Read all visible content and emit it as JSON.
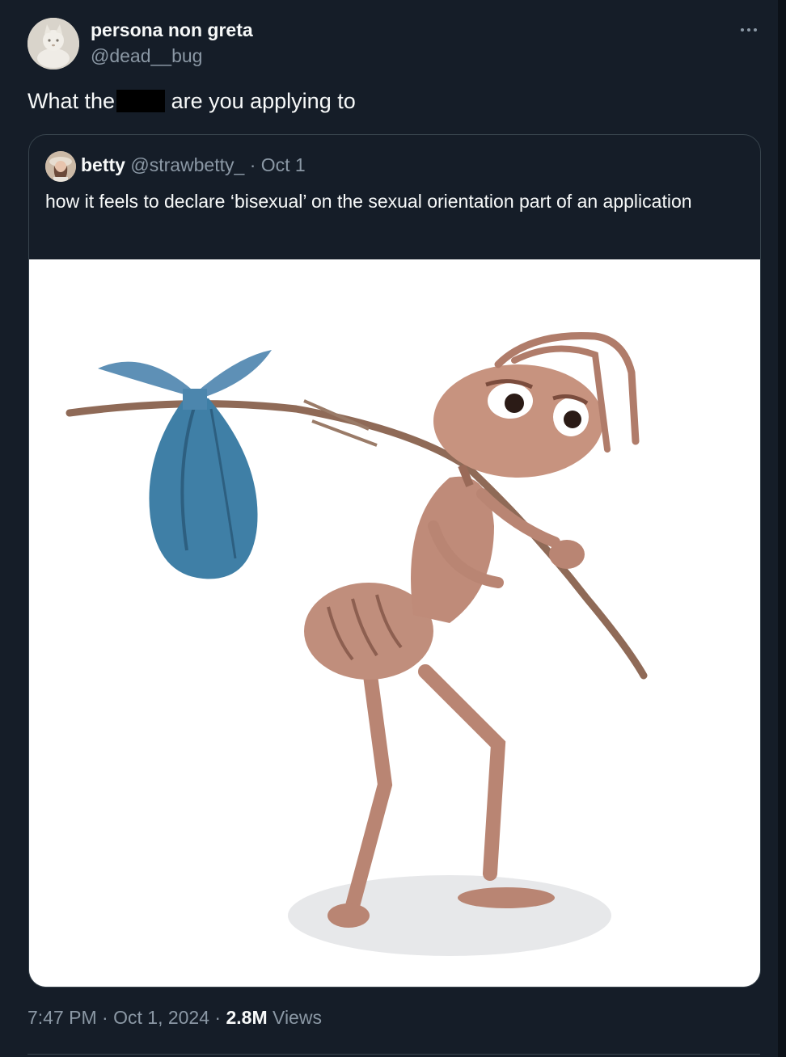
{
  "author": {
    "name": "persona non greta",
    "handle": "@dead__bug",
    "avatar_icon": "cat-statue-avatar"
  },
  "tweet": {
    "text_before": "What the",
    "text_after": "are you applying to",
    "redacted": true
  },
  "quoted": {
    "name": "betty",
    "handle": "@strawbetty_",
    "sep": "·",
    "date": "Oct 1",
    "text": "how it feels to declare ‘bisexual’ on the sexual orientation part of an application",
    "media_icon": "ant-with-bindle-illustration"
  },
  "footer": {
    "time": "7:47 PM",
    "sep": "·",
    "date": "Oct 1, 2024",
    "views_count": "2.8M",
    "views_label": "Views"
  },
  "icons": {
    "more": "more-horizontal-icon"
  },
  "colors": {
    "background": "#151d28",
    "text_primary": "#f7f9f9",
    "text_secondary": "#8b98a5",
    "border": "#38444d"
  }
}
